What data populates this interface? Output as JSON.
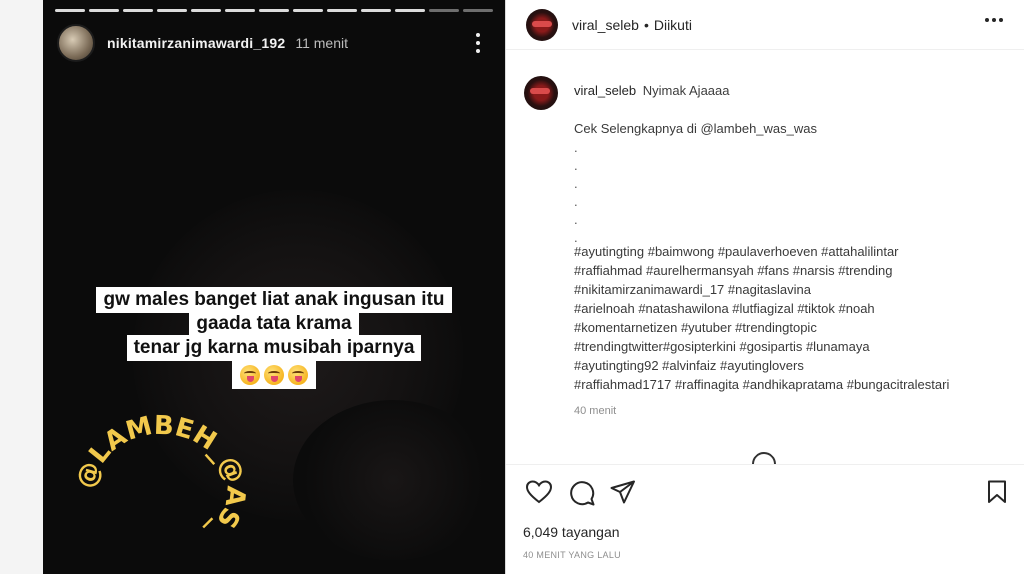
{
  "story": {
    "username": "nikitamirzanimawardi_192",
    "time": "11 menit",
    "progress_total": 13,
    "progress_viewed": 11,
    "caption_lines": [
      "gw males banget liat anak ingusan itu",
      "gaada tata krama",
      "tenar jg karna musibah iparnya"
    ],
    "emoji": [
      "😛",
      "😛",
      "😛"
    ],
    "watermark": "@LAMBEH_@AS_@AS"
  },
  "post": {
    "header": {
      "username": "viral_seleb",
      "separator": "•",
      "follow_status": "Diikuti"
    },
    "comment": {
      "username": "viral_seleb",
      "headline": "Nyimak Ajaaaa",
      "cta": "Cek Selengkapnya di @lambeh_was_was",
      "dots": [
        ".",
        ".",
        ".",
        ".",
        ".",
        "."
      ],
      "hashtag_lines": [
        "#ayutingting #baimwong #paulaverhoeven #attahalilintar",
        "#raffiahmad #aurelhermansyah #fans #narsis #trending",
        "#nikitamirzanimawardi_17 #nagitaslavina",
        "#arielnoah #natashawilona #lutfiagizal #tiktok #noah",
        "#komentarnetizen #yutuber #trendingtopic",
        "#trendingtwitter#gosipterkini #gosipartis #lunamaya",
        "#ayutingting92 #alvinfaiz #ayutinglovers",
        "#raffiahmad1717 #raffinagita #andhikapratama #bungacitralestari"
      ],
      "time": "40 menit"
    },
    "views": "6,049 tayangan",
    "posted_ago": "40 MENIT YANG LALU"
  }
}
